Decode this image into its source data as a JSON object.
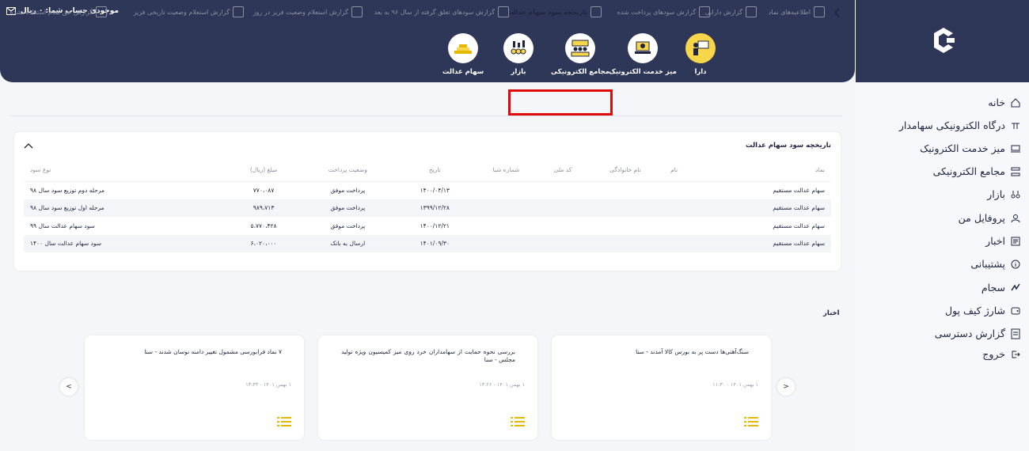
{
  "header": {
    "balance": "موجودی حساب شما: ۰ ریال",
    "tiles": [
      {
        "label": "دارا",
        "icon": "person-board-icon",
        "active": true
      },
      {
        "label": "میز خدمت الکترونیک",
        "icon": "service-desk-icon",
        "active": false
      },
      {
        "label": "مجامع الکترونیکی",
        "icon": "assembly-icon",
        "active": false
      },
      {
        "label": "بازار",
        "icon": "market-icon",
        "active": false
      },
      {
        "label": "سهام عدالت",
        "icon": "justice-shares-icon",
        "active": false
      }
    ]
  },
  "sidebar": {
    "items": [
      {
        "label": "خانه",
        "icon": "home-icon"
      },
      {
        "label": "درگاه الکترونیکی سهامدار",
        "icon": "gateway-icon"
      },
      {
        "label": "میز خدمت الکترونیک",
        "icon": "service-desk-icon"
      },
      {
        "label": "مجامع الکترونیکی",
        "icon": "assembly-icon"
      },
      {
        "label": "بازار",
        "icon": "market-icon"
      },
      {
        "label": "پروفایل من",
        "icon": "user-icon"
      },
      {
        "label": "اخبار",
        "icon": "news-icon"
      },
      {
        "label": "پشتیبانی",
        "icon": "info-icon"
      },
      {
        "label": "سجام",
        "icon": "sejam-icon"
      },
      {
        "label": "شارژ کیف پول",
        "icon": "wallet-icon"
      },
      {
        "label": "گزارش دسترسی",
        "icon": "access-report-icon"
      },
      {
        "label": "خروج",
        "icon": "logout-icon"
      }
    ]
  },
  "subtabs": [
    {
      "label": "اطلاعیه‌های نماد",
      "active": false
    },
    {
      "label": "گزارش دارایی",
      "active": false
    },
    {
      "label": "گزارش سودهای پرداخت شده",
      "active": false
    },
    {
      "label": "تاریخچه سود سهام عدالت",
      "active": true
    },
    {
      "label": "گزارش سودهای تعلق گرفته از سال ۹۶ به بعد",
      "active": false
    },
    {
      "label": "گزارش استعلام وضعیت فریز در روز",
      "active": false
    },
    {
      "label": "گزارش استعلام وضعیت تاریخی فریز",
      "active": false
    },
    {
      "label": "گزارش حق تقدم استفاده نشده",
      "active": false
    }
  ],
  "card": {
    "title": "تاریخچه سود سهام عدالت",
    "columns": [
      "نماد",
      "نام",
      "نام خانوادگی",
      "کد ملی",
      "شماره شبا",
      "تاریخ",
      "وضعیت پرداخت",
      "مبلغ (ریال)",
      "نوع سود"
    ],
    "rows": [
      [
        "سهام عدالت مستقیم",
        "",
        "",
        "",
        "",
        "۱۴۰۰/۰۴/۱۳",
        "پرداخت موفق",
        "۷۷۰،۰۸۷",
        "مرحله دوم توزیع سود سال ۹۸"
      ],
      [
        "سهام عدالت مستقیم",
        "",
        "",
        "",
        "",
        "۱۳۹۹/۱۲/۲۸",
        "پرداخت موفق",
        "۹۸۹،۷۱۳",
        "مرحله اول توزیع سود سال ۹۸"
      ],
      [
        "سهام عدالت مستقیم",
        "",
        "",
        "",
        "",
        "۱۴۰۰/۱۲/۲۱",
        "پرداخت موفق",
        "۵،۷۷۰،۴۲۸",
        "سود سهام عدالت سال ۹۹"
      ],
      [
        "سهام عدالت مستقیم",
        "",
        "",
        "",
        "",
        "۱۴۰۱/۰۹/۳۰",
        "ارسال به بانک",
        "۶،۰۲۰،۰۰۰",
        "سود سهام عدالت سال ۱۴۰۰"
      ]
    ]
  },
  "news": {
    "title": "اخبار",
    "prev": "<",
    "next": ">",
    "items": [
      {
        "title": "سنگ‌آهنی‌ها دست پر به بورس کالا آمدند - سنا",
        "date": "۱ بهمن ۱۴۰۱ - ۱۱:۳۰"
      },
      {
        "title": "بررسی نحوه حمایت از سهامداران خرد روی میز کمیسیون ویژه تولید مجلس - سنا",
        "date": "۱ بهمن ۱۴۰۱ - ۱۳:۲۶"
      },
      {
        "title": "۷ نماد فرابورسی مشمول تغییر دامنه نوسان شدند - سنا",
        "date": "۱ بهمن ۱۴۰۱ - ۱۳:۳۳"
      }
    ]
  },
  "colors": {
    "header": "#2f3758",
    "accent": "#f7d64a",
    "highlight": "#e10a0a",
    "menu_gold": "#e6b800"
  }
}
